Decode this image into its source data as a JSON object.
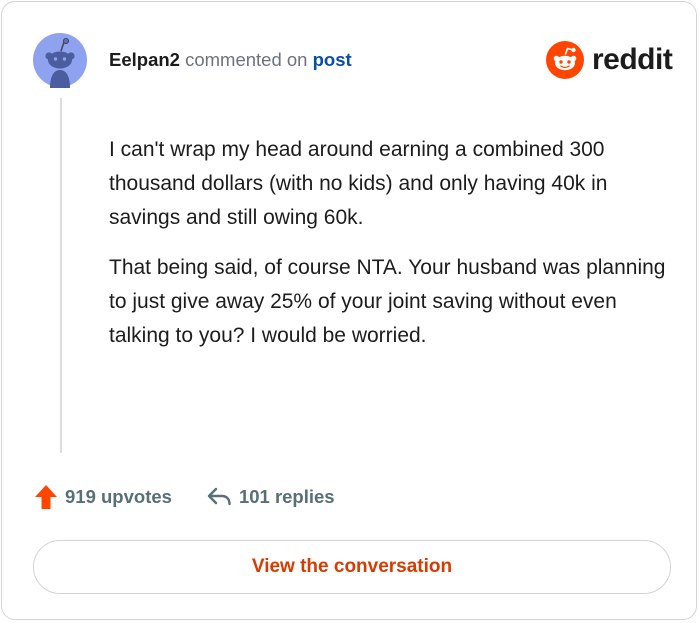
{
  "comment": {
    "username": "Eelpan2",
    "commented_text": "commented on",
    "post_link": "post",
    "paragraphs": [
      "I can't wrap my head around earning a combined 300 thousand dollars (with no kids) and only having 40k in savings and still owing 60k.",
      "That being said, of course NTA. Your husband was planning to just give away 25% of your joint saving without even talking to you? I would be worried."
    ]
  },
  "brand": {
    "name": "reddit",
    "icon": "reddit-snoo-icon",
    "color": "#ff4500"
  },
  "actions": {
    "upvotes_label": "919 upvotes",
    "replies_label": "101 replies",
    "upvote_icon": "upvote-arrow-icon",
    "reply_icon": "reply-arrow-icon",
    "upvote_color": "#ff4500"
  },
  "view_button": {
    "label": "View the conversation",
    "color": "#d93a00"
  }
}
